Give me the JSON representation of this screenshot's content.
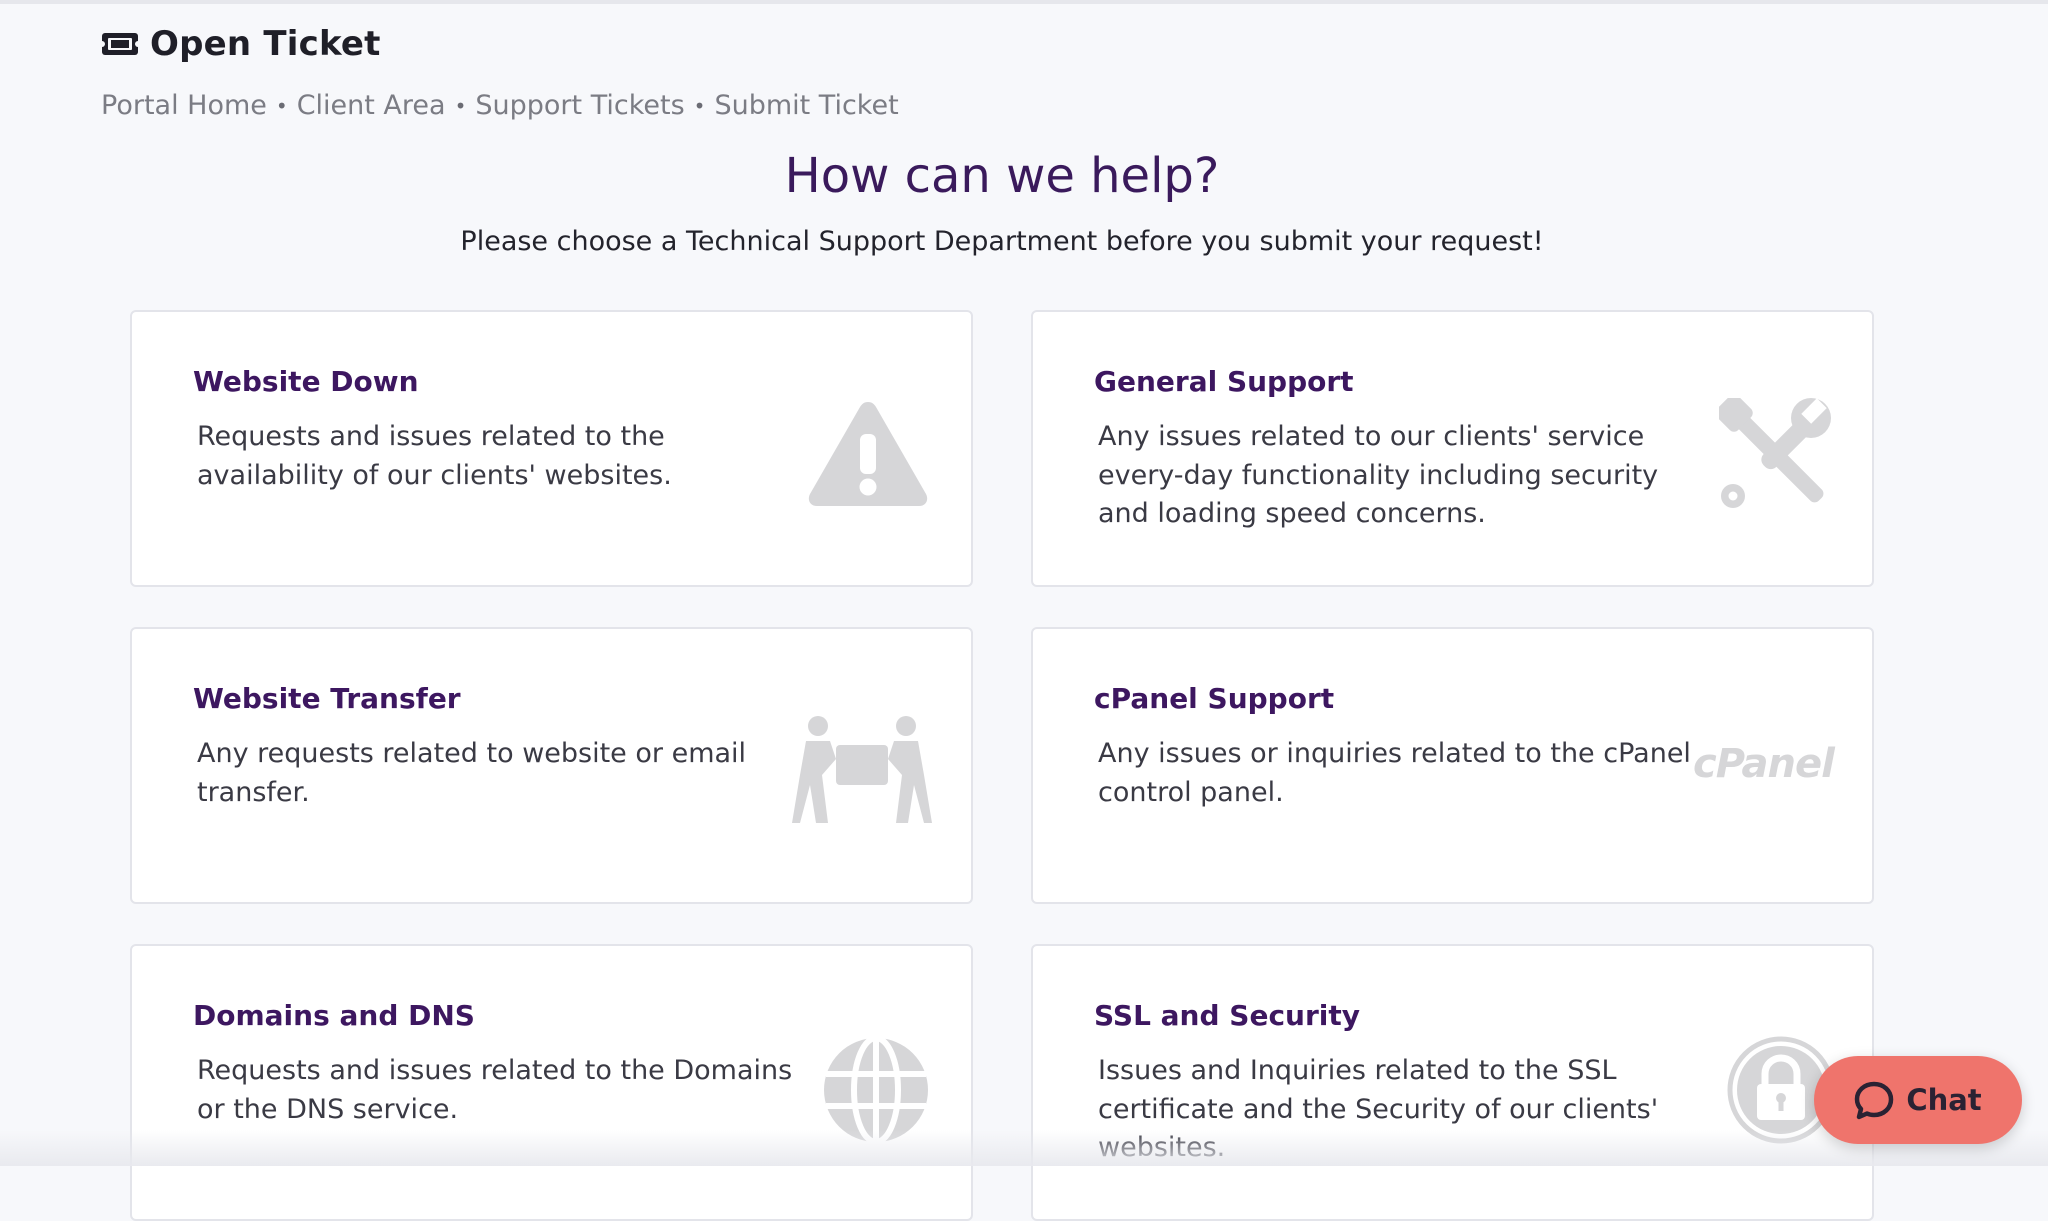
{
  "header": {
    "title": "Open Ticket",
    "icon": "ticket-icon",
    "breadcrumb": [
      {
        "label": "Portal Home"
      },
      {
        "label": "Client Area"
      },
      {
        "label": "Support Tickets"
      },
      {
        "label": "Submit Ticket"
      }
    ],
    "separator": "•"
  },
  "hero": {
    "title": "How can we help?",
    "subtitle": "Please choose a Technical Support Department before you submit your request!"
  },
  "departments": [
    {
      "title": "Website Down",
      "description": "Requests and issues related to the availability of our clients' websites.",
      "icon": "warning-icon"
    },
    {
      "title": "General Support",
      "description": "Any issues related to our clients' service every-day functionality including security and loading speed concerns.",
      "icon": "tools-icon"
    },
    {
      "title": "Website Transfer",
      "description": "Any requests related to website or email transfer.",
      "icon": "movers-icon"
    },
    {
      "title": "cPanel Support",
      "description": "Any issues or inquiries related to the cPanel control panel.",
      "icon": "cpanel-logo",
      "logo_text": "cPanel"
    },
    {
      "title": "Domains and DNS",
      "description": "Requests and issues related to the Domains or the DNS service.",
      "icon": "globe-icon"
    },
    {
      "title": "SSL and Security",
      "description": "Issues and Inquiries related to the SSL certificate and the Security of our clients' websites.",
      "icon": "lock-icon"
    }
  ],
  "chat": {
    "label": "Chat",
    "icon": "chat-bubble-icon"
  },
  "colors": {
    "accent_purple": "#3d1760",
    "hero_purple": "#3a1a5c",
    "chat_coral": "#ef746c",
    "icon_gray": "#d6d6d8",
    "page_bg": "#f7f8fb"
  }
}
